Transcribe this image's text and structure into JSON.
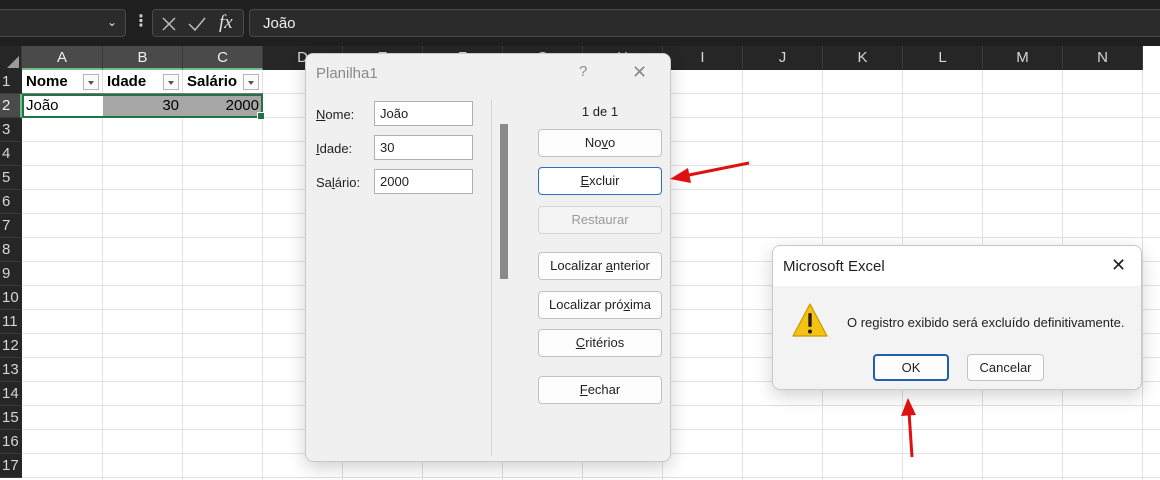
{
  "formula_bar": {
    "name_box_value": "",
    "function_label": "fx",
    "formula_value": "João"
  },
  "sheet": {
    "columns": [
      "A",
      "B",
      "C",
      "D",
      "E",
      "F",
      "G",
      "H",
      "I",
      "J",
      "K",
      "L",
      "M",
      "N"
    ],
    "rows": [
      "1",
      "2",
      "3",
      "4",
      "5",
      "6",
      "7",
      "8",
      "9",
      "10",
      "11",
      "12",
      "13",
      "14",
      "15",
      "16",
      "17"
    ],
    "table_headers": [
      "Nome",
      "Idade",
      "Salário"
    ],
    "table_row": [
      "João",
      "30",
      "2000"
    ]
  },
  "data_form": {
    "title": "Planilha1",
    "help": "?",
    "close": "✕",
    "fields": [
      {
        "label_pre": "",
        "label_key": "N",
        "label_post": "ome:",
        "value": "João"
      },
      {
        "label_pre": "",
        "label_key": "I",
        "label_post": "dade:",
        "value": "30"
      },
      {
        "label_pre": "Sa",
        "label_key": "l",
        "label_post": "ário:",
        "value": "2000"
      }
    ],
    "record_counter": "1 de 1",
    "buttons": [
      {
        "pre": "No",
        "key": "v",
        "post": "o"
      },
      {
        "pre": "",
        "key": "E",
        "post": "xcluir"
      },
      {
        "pre": "",
        "key": "R",
        "post": "estaurar"
      },
      {
        "pre": "Localizar ",
        "key": "a",
        "post": "nterior"
      },
      {
        "pre": "Localizar pró",
        "key": "x",
        "post": "ima"
      },
      {
        "pre": "",
        "key": "C",
        "post": "ritérios"
      },
      {
        "pre": "",
        "key": "F",
        "post": "echar"
      }
    ]
  },
  "message_box": {
    "title": "Microsoft Excel",
    "close": "✕",
    "message": "O registro exibido será excluído definitivamente.",
    "ok_label": "OK",
    "cancel_label": "Cancelar"
  },
  "colors": {
    "accent_green": "#217346",
    "arrow_red": "#e01010",
    "warning_yellow": "#f5c211"
  }
}
